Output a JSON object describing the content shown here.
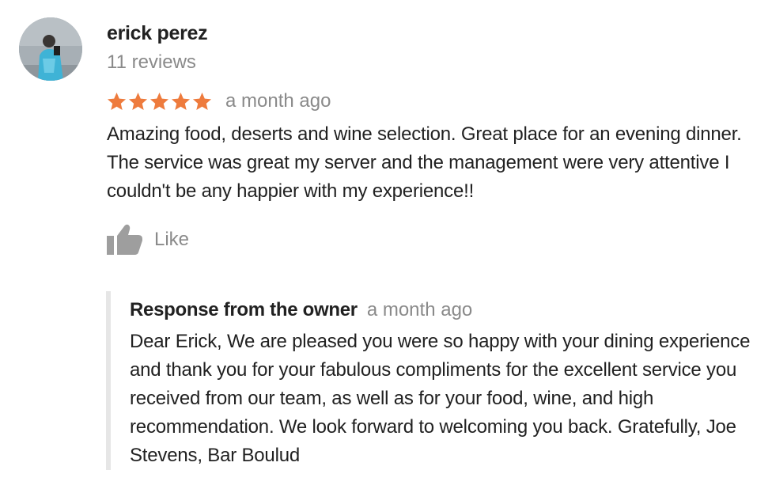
{
  "review": {
    "author_name": "erick perez",
    "review_count": "11 reviews",
    "rating": 5,
    "max_rating": 5,
    "time_ago": "a month ago",
    "text": "Amazing food, deserts and wine selection. Great place for an evening dinner. The service was great my server and the management were very attentive I couldn't be any happier with my experience!!",
    "like_label": "Like",
    "avatar_icon": "user-avatar-photo",
    "like_icon": "thumbs-up-icon",
    "star_icon": "star-icon"
  },
  "owner_response": {
    "title": "Response from the owner",
    "time_ago": "a month ago",
    "text": "Dear Erick, We are pleased you were so happy with your dining experience and thank you for your fabulous compliments for the excellent service you received from our team, as well as for your food, wine, and high recommendation. We look forward to welcoming you back. Gratefully, Joe Stevens, Bar Boulud"
  },
  "colors": {
    "star": "#ee7b3d",
    "secondary_text": "#8a8a8a",
    "primary_text": "#212121",
    "response_border": "#e6e6e6",
    "like_icon": "#9e9e9e"
  }
}
